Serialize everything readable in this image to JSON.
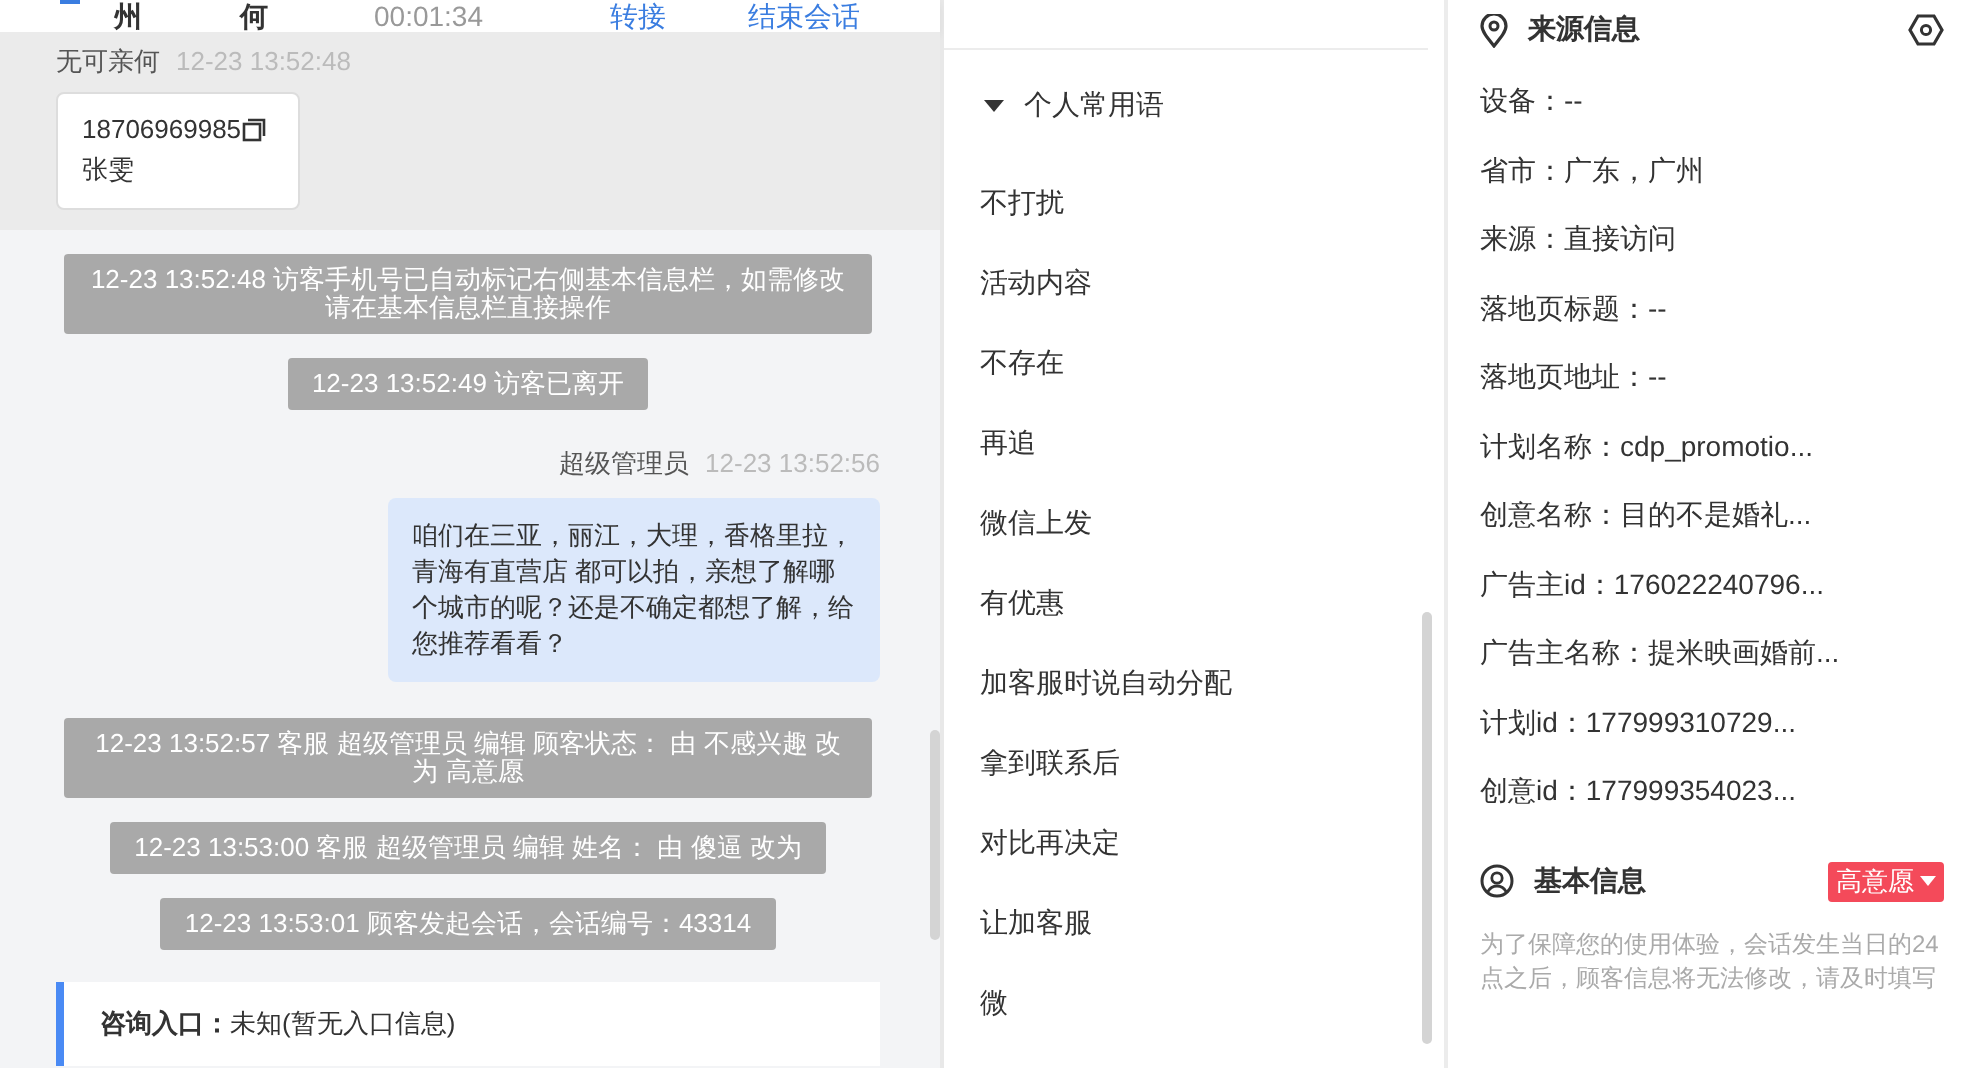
{
  "header": {
    "cells": [
      "州",
      "何",
      "00:01:34"
    ],
    "actions": [
      "转接",
      "结束会话"
    ]
  },
  "messages": [
    {
      "kind": "customer",
      "sender": "无可亲何",
      "time": "12-23 13:52:48",
      "phone": "18706969985",
      "name": "张雯"
    },
    {
      "kind": "system",
      "text": "12-23 13:52:48 访客手机号已自动标记右侧基本信息栏，如需修改请在基本信息栏直接操作"
    },
    {
      "kind": "system",
      "text": "12-23 13:52:49 访客已离开"
    },
    {
      "kind": "agent",
      "sender": "超级管理员",
      "time": "12-23 13:52:56",
      "text": "咱们在三亚，丽江，大理，香格里拉，青海有直营店 都可以拍，亲想了解哪个城市的呢？还是不确定都想了解，给您推荐看看？"
    },
    {
      "kind": "system",
      "text": "12-23 13:52:57 客服 超级管理员 编辑 顾客状态： 由 不感兴趣 改为 高意愿"
    },
    {
      "kind": "system",
      "text": "12-23 13:53:00 客服 超级管理员 编辑 姓名： 由 傻逼 改为"
    },
    {
      "kind": "system",
      "text": "12-23 13:53:01 顾客发起会话，会话编号：43314"
    },
    {
      "kind": "entry",
      "label": "咨询入口：",
      "value": "未知(暂无入口信息)"
    }
  ],
  "phrases": {
    "title": "个人常用语",
    "expanded": true,
    "items": [
      "不打扰",
      "活动内容",
      "不存在",
      "再追",
      "微信上发",
      "有优惠",
      "加客服时说自动分配",
      "拿到联系后",
      "对比再决定",
      "让加客服",
      "微"
    ]
  },
  "source_info": {
    "title": "来源信息",
    "fields": [
      "设备：--",
      "省市：广东，广州",
      "来源：直接访问",
      "落地页标题：--",
      "落地页地址：--",
      "计划名称：cdp_promotio...",
      "创意名称：目的不是婚礼...",
      "广告主id：176022240796...",
      "广告主名称：提米映画婚前...",
      "计划id：177999310729...",
      "创意id：177999354023..."
    ]
  },
  "basic_info": {
    "title": "基本信息",
    "status": "高意愿",
    "note": "为了保障您的使用体验，会话发生当日的24点之后，顾客信息将无法修改，请及时填写"
  }
}
